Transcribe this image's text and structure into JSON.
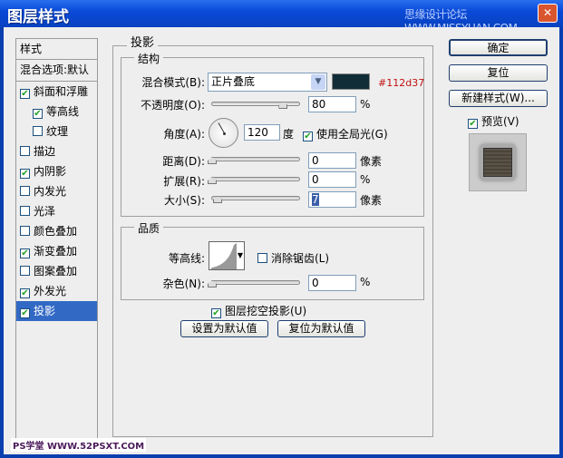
{
  "window": {
    "title": "图层样式",
    "watermark": "思缘设计论坛 WWW.MISSYUAN.COM",
    "bottom_watermark": "PS学堂 WWW.52PSXT.COM"
  },
  "sidebar": {
    "header": "样式",
    "blend": "混合选项:默认",
    "items": [
      {
        "label": "斜面和浮雕",
        "checked": true,
        "indent": false
      },
      {
        "label": "等高线",
        "checked": true,
        "indent": true
      },
      {
        "label": "纹理",
        "checked": false,
        "indent": true
      },
      {
        "label": "描边",
        "checked": false,
        "indent": false
      },
      {
        "label": "内阴影",
        "checked": true,
        "indent": false
      },
      {
        "label": "内发光",
        "checked": false,
        "indent": false
      },
      {
        "label": "光泽",
        "checked": false,
        "indent": false
      },
      {
        "label": "颜色叠加",
        "checked": false,
        "indent": false
      },
      {
        "label": "渐变叠加",
        "checked": true,
        "indent": false
      },
      {
        "label": "图案叠加",
        "checked": false,
        "indent": false
      },
      {
        "label": "外发光",
        "checked": true,
        "indent": false
      },
      {
        "label": "投影",
        "checked": true,
        "indent": false,
        "selected": true
      }
    ]
  },
  "main": {
    "section": "投影",
    "structure": {
      "title": "结构",
      "blend_mode_label": "混合模式(B):",
      "blend_mode": "正片叠底",
      "color": "#112d37",
      "color_note": "#112d37",
      "opacity_label": "不透明度(O):",
      "opacity": "80",
      "opacity_unit": "%",
      "angle_label": "角度(A):",
      "angle": "120",
      "angle_unit": "度",
      "global_light_label": "使用全局光(G)",
      "global_light": true,
      "distance_label": "距离(D):",
      "distance": "0",
      "distance_unit": "像素",
      "spread_label": "扩展(R):",
      "spread": "0",
      "spread_unit": "%",
      "size_label": "大小(S):",
      "size": "7",
      "size_unit": "像素"
    },
    "quality": {
      "title": "品质",
      "contour_label": "等高线:",
      "antialias_label": "消除锯齿(L)",
      "antialias": false,
      "noise_label": "杂色(N):",
      "noise": "0",
      "noise_unit": "%"
    },
    "knockout_label": "图层挖空投影(U)",
    "knockout": true,
    "make_default": "设置为默认值",
    "reset_default": "复位为默认值"
  },
  "buttons": {
    "ok": "确定",
    "reset": "复位",
    "new_style": "新建样式(W)...",
    "preview_label": "预览(V)",
    "preview": true
  }
}
